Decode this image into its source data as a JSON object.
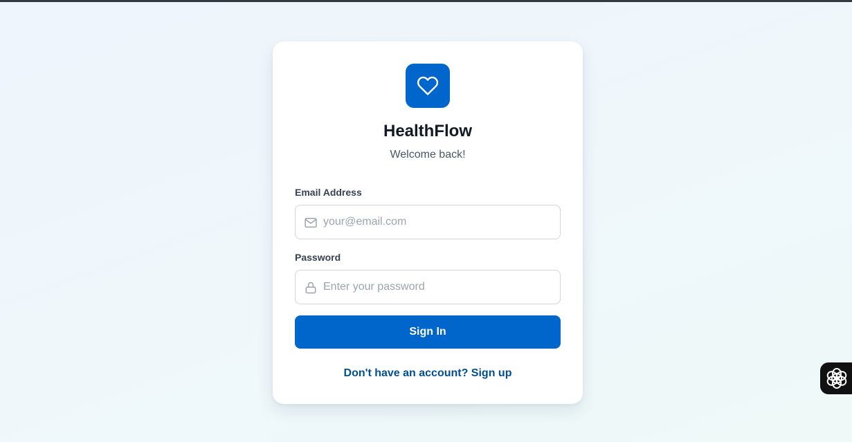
{
  "app": {
    "title": "HealthFlow",
    "subtitle": "Welcome back!",
    "logo_icon": "heart-icon",
    "accent_color": "#0066cc"
  },
  "form": {
    "email_label": "Email Address",
    "email_placeholder": "your@email.com",
    "email_value": "",
    "email_icon": "mail-icon",
    "password_label": "Password",
    "password_placeholder": "Enter your password",
    "password_value": "",
    "password_icon": "lock-icon",
    "submit_label": "Sign In"
  },
  "footer": {
    "signup_text": "Don't have an account? Sign up"
  },
  "floating_widget": {
    "icon": "assistant-flower-icon"
  }
}
